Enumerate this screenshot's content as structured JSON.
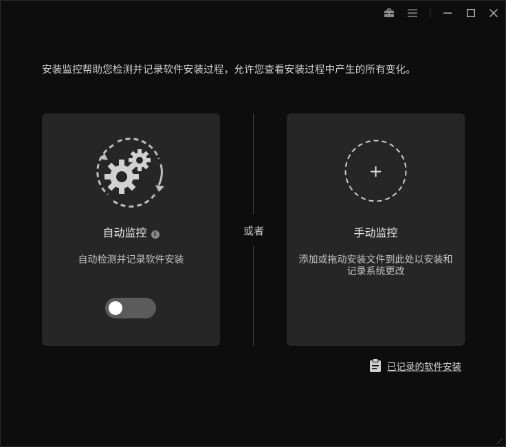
{
  "window": {
    "controls": [
      "toolbox-icon",
      "menu-icon",
      "minimize-icon",
      "maximize-icon",
      "close-icon"
    ]
  },
  "intro_text": "安装监控帮助您检测并记录软件安装过程，允许您查看安装过程中产生的所有变化。",
  "auto_card": {
    "title": "自动监控",
    "info_icon": "i",
    "description": "自动检测并记录软件安装",
    "toggle_state": "off"
  },
  "or_label": "或者",
  "manual_card": {
    "title": "手动监控",
    "add_symbol": "+",
    "description": "添加或拖动安装文件到此处以安装和记录系统更改"
  },
  "history_link": {
    "label": "已记录的软件安装",
    "icon": "clipboard-icon"
  }
}
